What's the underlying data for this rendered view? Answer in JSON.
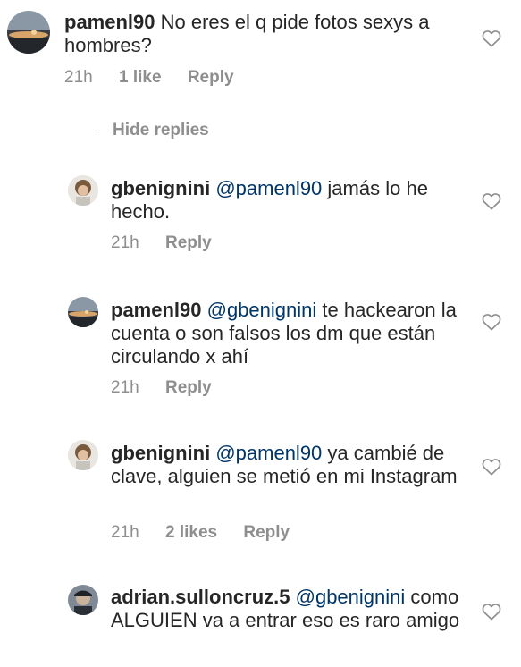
{
  "comments": [
    {
      "username": "pamenl90",
      "text": "No eres el q pide fotos sexys a hombres?",
      "time": "21h",
      "likes": "1 like",
      "reply": "Reply",
      "avatar": "sunset-landscape"
    },
    {
      "username": "gbenignini",
      "mention": "@pamenl90",
      "text": "jamás lo he hecho.",
      "time": "21h",
      "reply": "Reply",
      "avatar": "curly-hair-person"
    },
    {
      "username": "pamenl90",
      "mention": "@gbenignini",
      "text": "te hackearon la cuenta o son falsos los dm que están circulando x ahí",
      "time": "21h",
      "reply": "Reply",
      "avatar": "sunset-landscape"
    },
    {
      "username": "gbenignini",
      "mention": "@pamenl90",
      "text": "ya cambié de clave, alguien se metió en mi Instagram",
      "time": "21h",
      "likes": "2 likes",
      "reply": "Reply",
      "avatar": "curly-hair-person"
    },
    {
      "username": "adrian.sulloncruz.5",
      "mention": "@gbenignini",
      "text": "como ALGUIEN va a entrar eso es raro amigo",
      "avatar": "person-with-cap"
    }
  ],
  "hide_replies": "Hide replies",
  "colors": {
    "text": "#262626",
    "meta": "#8e8e8e",
    "mention": "#003569",
    "heart": "#8e8e8e"
  },
  "icons": [
    "heart-outline-icon"
  ]
}
